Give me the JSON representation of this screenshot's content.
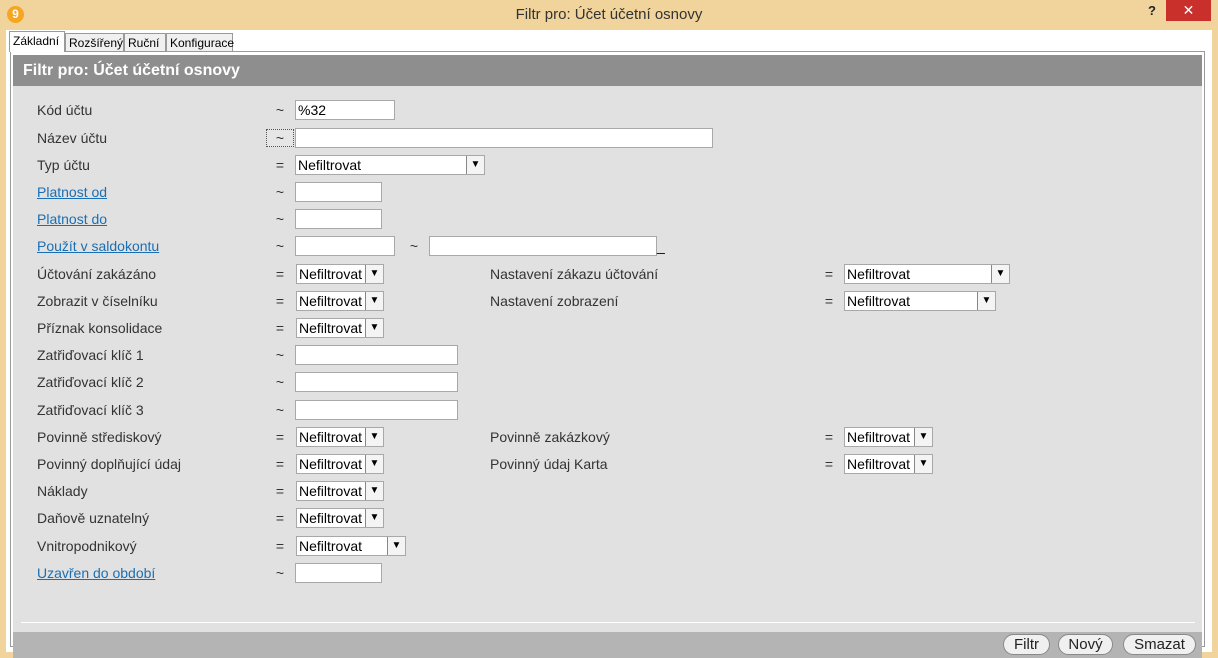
{
  "window": {
    "title": "Filtr pro: Účet účetní osnovy",
    "app_icon_glyph": "9",
    "help_label": "?",
    "close_label": "✕"
  },
  "tabs": [
    {
      "label": "Základní"
    },
    {
      "label": "Rozšířený"
    },
    {
      "label": "Ruční"
    },
    {
      "label": "Konfigurace"
    }
  ],
  "header": {
    "title": "Filtr pro: Účet účetní osnovy"
  },
  "fields": {
    "kod_uctu": {
      "label": "Kód účtu",
      "op": "~",
      "value": "%32"
    },
    "nazev_uctu": {
      "label": "Název účtu",
      "op": "~",
      "value": ""
    },
    "typ_uctu": {
      "label": "Typ účtu",
      "op": "=",
      "value": "Nefiltrovat"
    },
    "platnost_od": {
      "label": "Platnost od",
      "op": "~",
      "value": ""
    },
    "platnost_do": {
      "label": "Platnost do",
      "op": "~",
      "value": ""
    },
    "pouzit_saldo": {
      "label": "Použít v saldokontu",
      "op": "~",
      "value": "",
      "op2": "~",
      "value2": "",
      "extra": "_"
    },
    "uctovani_zakazano": {
      "label": "Účtování zakázáno",
      "op": "=",
      "value": "Nefiltrovat"
    },
    "nastaveni_zakazu": {
      "label": "Nastavení zákazu účtování",
      "op": "=",
      "value": "Nefiltrovat"
    },
    "zobrazit_ciselnik": {
      "label": "Zobrazit v číselníku",
      "op": "=",
      "value": "Nefiltrovat"
    },
    "nastaveni_zobrazeni": {
      "label": "Nastavení zobrazení",
      "op": "=",
      "value": "Nefiltrovat"
    },
    "priznak_konsolidace": {
      "label": "Příznak konsolidace",
      "op": "=",
      "value": "Nefiltrovat"
    },
    "klic1": {
      "label": "Zatřiďovací klíč 1",
      "op": "~",
      "value": ""
    },
    "klic2": {
      "label": "Zatřiďovací klíč 2",
      "op": "~",
      "value": ""
    },
    "klic3": {
      "label": "Zatřiďovací klíč 3",
      "op": "~",
      "value": ""
    },
    "povinne_strediskovy": {
      "label": "Povinně střediskový",
      "op": "=",
      "value": "Nefiltrovat"
    },
    "povinne_zakazkovy": {
      "label": "Povinně zakázkový",
      "op": "=",
      "value": "Nefiltrovat"
    },
    "povinny_doplnujici": {
      "label": "Povinný doplňující údaj",
      "op": "=",
      "value": "Nefiltrovat"
    },
    "povinny_karta": {
      "label": "Povinný údaj Karta",
      "op": "=",
      "value": "Nefiltrovat"
    },
    "naklady": {
      "label": "Náklady",
      "op": "=",
      "value": "Nefiltrovat"
    },
    "danove_uznatelny": {
      "label": "Daňově uznatelný",
      "op": "=",
      "value": "Nefiltrovat"
    },
    "vnitropodnikovy": {
      "label": "Vnitropodnikový",
      "op": "=",
      "value": "Nefiltrovat"
    },
    "uzavren_do": {
      "label": "Uzavřen do období",
      "op": "~",
      "value": ""
    }
  },
  "buttons": {
    "filtr": "Filtr",
    "novy": "Nový",
    "smazat": "Smazat"
  },
  "colors": {
    "window_frame": "#f0d49c",
    "close": "#c9302c",
    "header": "#8e8e8e",
    "link": "#1a6fb4"
  }
}
